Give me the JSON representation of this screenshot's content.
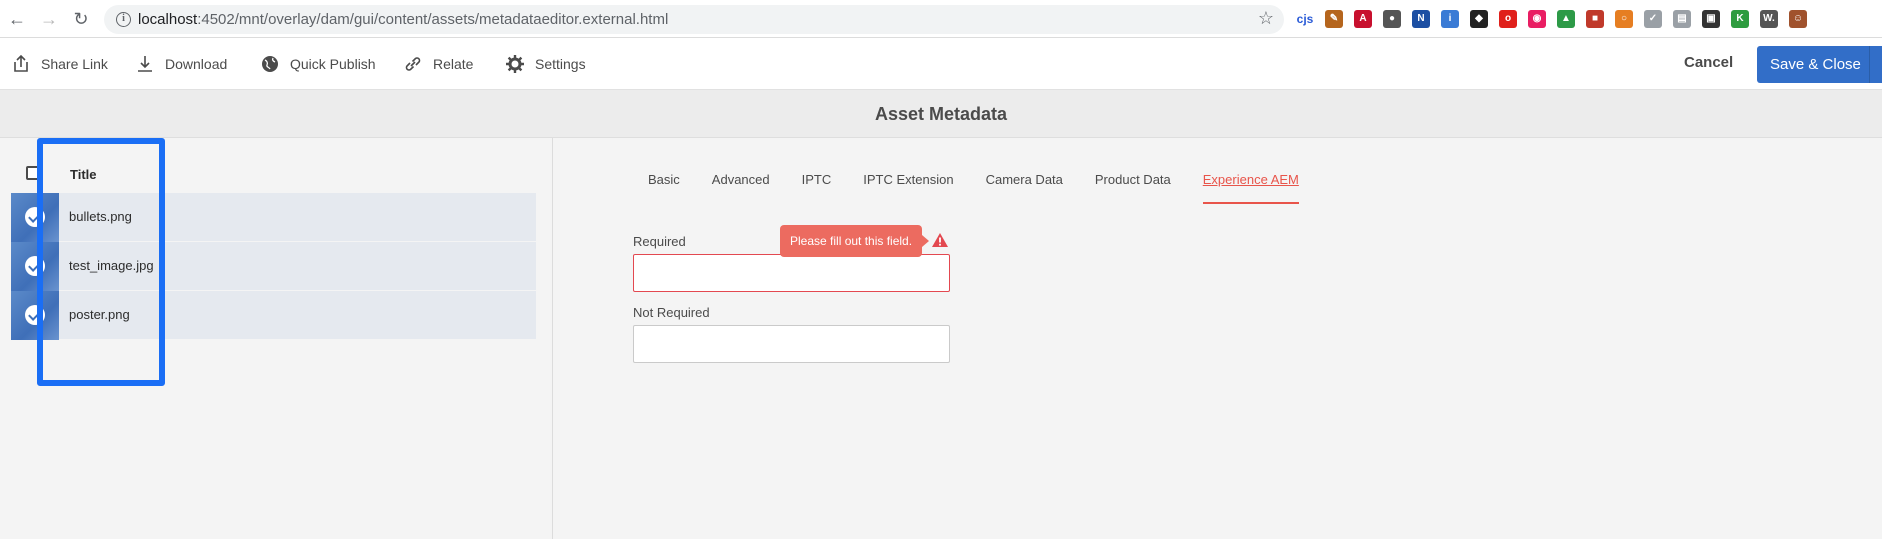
{
  "browser": {
    "url_host": "localhost",
    "url_rest": ":4502/mnt/overlay/dam/gui/content/assets/metadataeditor.external.html",
    "extensions": [
      {
        "name": "cjs-icon",
        "label": "cjs",
        "color": "#2a5bd7",
        "text_color": "#2a5bd7"
      },
      {
        "name": "pen-icon",
        "label": "✎",
        "color": "#b5651d"
      },
      {
        "name": "acrobat-icon",
        "label": "A",
        "color": "#c8102e"
      },
      {
        "name": "circle-icon",
        "label": "●",
        "color": "#555555"
      },
      {
        "name": "news-icon",
        "label": "N",
        "color": "#1c4fa3"
      },
      {
        "name": "blue-circle-icon",
        "label": "i",
        "color": "#3a7bd5"
      },
      {
        "name": "spy-icon",
        "label": "◆",
        "color": "#222222"
      },
      {
        "name": "red-icon",
        "label": "o",
        "color": "#e0201b"
      },
      {
        "name": "ring-icon",
        "label": "◉",
        "color": "#e91e63"
      },
      {
        "name": "drive-icon",
        "label": "▲",
        "color": "#2d9a47"
      },
      {
        "name": "red-square-icon",
        "label": "■",
        "color": "#c0392b"
      },
      {
        "name": "orange-ring-icon",
        "label": "○",
        "color": "#e67e22"
      },
      {
        "name": "check-icon",
        "label": "✓",
        "color": "#9aa0a6"
      },
      {
        "name": "page-icon",
        "label": "▤",
        "color": "#9aa0a6"
      },
      {
        "name": "black-icon",
        "label": "▣",
        "color": "#333333"
      },
      {
        "name": "k-icon",
        "label": "K",
        "color": "#2e9c3f"
      },
      {
        "name": "w-icon",
        "label": "W.",
        "color": "#555555"
      },
      {
        "name": "avatar",
        "label": "☺",
        "color": "#a0522d"
      }
    ]
  },
  "toolbar": {
    "actions": [
      {
        "label": "Share Link",
        "icon": "share-icon"
      },
      {
        "label": "Download",
        "icon": "download-icon"
      },
      {
        "label": "Quick Publish",
        "icon": "globe-icon"
      },
      {
        "label": "Relate",
        "icon": "link-icon"
      },
      {
        "label": "Settings",
        "icon": "gear-icon"
      }
    ],
    "cancel_label": "Cancel",
    "save_label": "Save & Close"
  },
  "page": {
    "title": "Asset Metadata"
  },
  "assets": {
    "column_title": "Title",
    "items": [
      "bullets.png",
      "test_image.jpg",
      "poster.png"
    ]
  },
  "tabs": {
    "items": [
      "Basic",
      "Advanced",
      "IPTC",
      "IPTC Extension",
      "Camera Data",
      "Product Data",
      "Experience AEM"
    ],
    "active": "Experience AEM"
  },
  "form": {
    "required_label": "Required",
    "required_value": "",
    "not_required_label": "Not Required",
    "not_required_value": "",
    "validation_message": "Please fill out this field."
  },
  "colors": {
    "accent": "#326ec8",
    "error": "#e34850",
    "highlight": "#1a6ef5"
  }
}
